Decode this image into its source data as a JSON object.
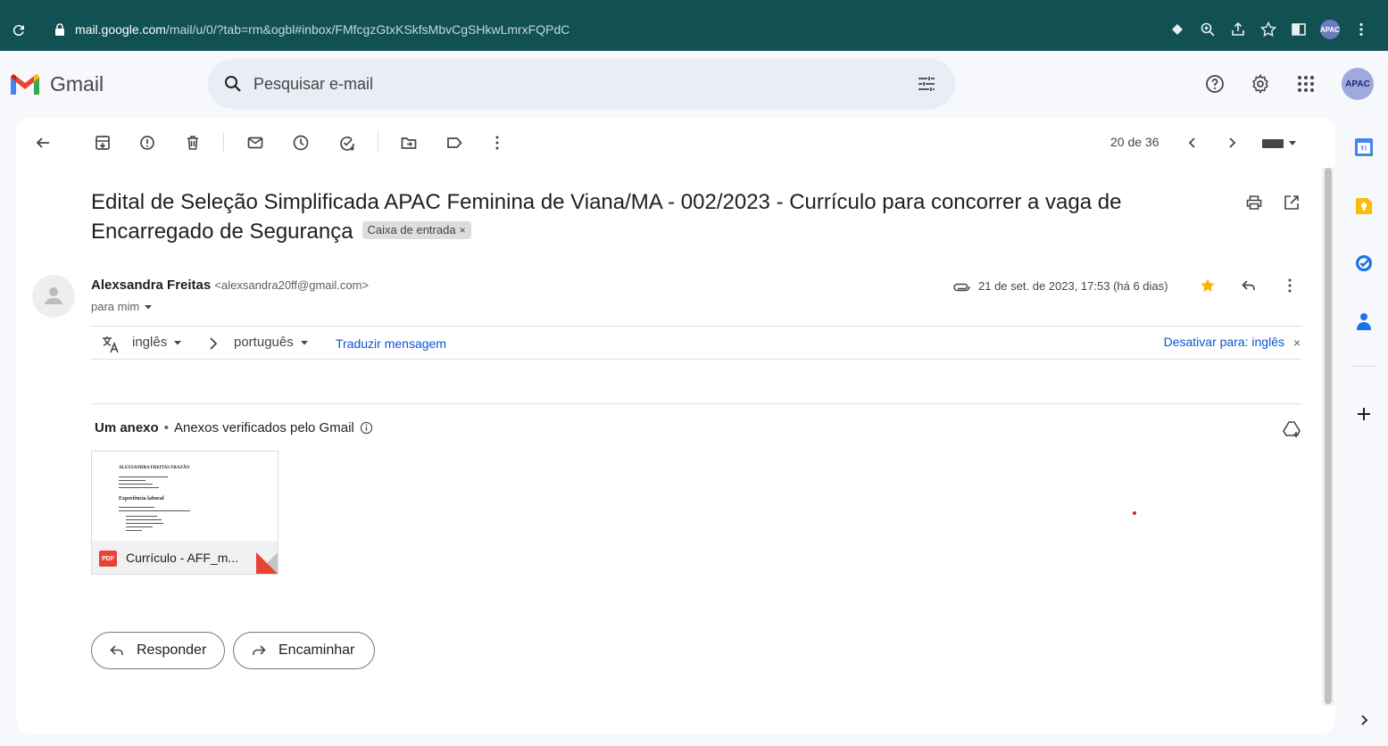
{
  "browser": {
    "url_host": "mail.google.com",
    "url_path": "/mail/u/0/?tab=rm&ogbl#inbox/FMfcgzGtxKSkfsMbvCgSHkwLmrxFQPdC",
    "profile_label": "APAC"
  },
  "header": {
    "app_name": "Gmail",
    "search_placeholder": "Pesquisar e-mail",
    "account_label": "APAC"
  },
  "toolbar": {
    "counter": "20 de 36"
  },
  "message": {
    "subject": "Edital de Seleção Simplificada APAC Feminina de Viana/MA - 002/2023 - Currículo para concorrer a vaga de Encarregado de Segurança",
    "label": "Caixa de entrada",
    "label_close": "×",
    "sender_name": "Alexsandra Freitas",
    "sender_email": "<alexsandra20ff@gmail.com>",
    "recipient": "para mim",
    "date": "21 de set. de 2023, 17:53 (há 6 dias)"
  },
  "translate": {
    "source_lang": "inglês",
    "target_lang": "português",
    "translate_link": "Traduzir mensagem",
    "disable_link": "Desativar para: inglês",
    "close": "×"
  },
  "attachments": {
    "title": "Um anexo",
    "separator": "•",
    "verified": "Anexos verificados pelo Gmail",
    "file_name": "Currículo - AFF_m...",
    "file_type": "PDF",
    "preview_heading": "ALEXSANDRA FREITAS FRAZÃO",
    "preview_section": "Experiência laboral"
  },
  "actions": {
    "reply": "Responder",
    "forward": "Encaminhar"
  },
  "colors": {
    "url_bar": "#115152",
    "accent_blue": "#0b57d0",
    "star": "#f4b400",
    "pdf_red": "#ea4335"
  }
}
